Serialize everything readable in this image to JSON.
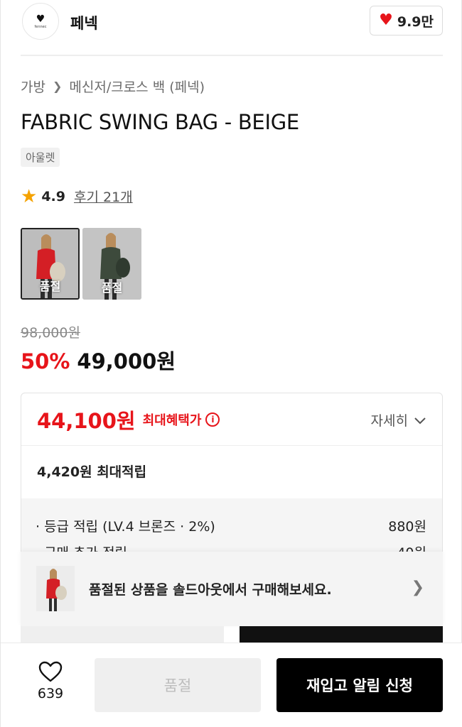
{
  "brand": {
    "name": "페넥",
    "logo_word": "fennec"
  },
  "like": {
    "count": "9.9만",
    "icon": "heart-filled-icon",
    "color": "#e7141a"
  },
  "breadcrumb": {
    "category": "가방",
    "subcategory": "메신저/크로스 백 (페넥)"
  },
  "product": {
    "title": "FABRIC SWING BAG - BEIGE",
    "tag": "아울렛",
    "rating": "4.9",
    "reviews": "후기 21개",
    "thumbnails": [
      {
        "label": "품절",
        "colorway": "red-beige"
      },
      {
        "label": "품절",
        "colorway": "khaki"
      }
    ],
    "original_price": "98,000원",
    "discount": "50%",
    "sale_price": "49,000원"
  },
  "benefit": {
    "best_price": "44,100원",
    "best_label": "최대혜택가",
    "info_icon": "i",
    "detail_label": "자세히",
    "points_summary": "4,420원 최대적립",
    "lines": [
      {
        "label": "· 등급 적립 (LV.4 브론즈 · 2%)",
        "value": "880원"
      },
      {
        "label": "· 구매 추가 적립",
        "value": "40원"
      }
    ]
  },
  "banner": {
    "text": "품절된 상품을 솔드아웃에서 구매해보세요."
  },
  "bottom": {
    "wish_count": "639",
    "soldout_label": "품절",
    "restock_label": "재입고 알림 신청"
  },
  "colors": {
    "accent": "#e7141a",
    "dark": "#000000",
    "muted": "#efefef"
  }
}
